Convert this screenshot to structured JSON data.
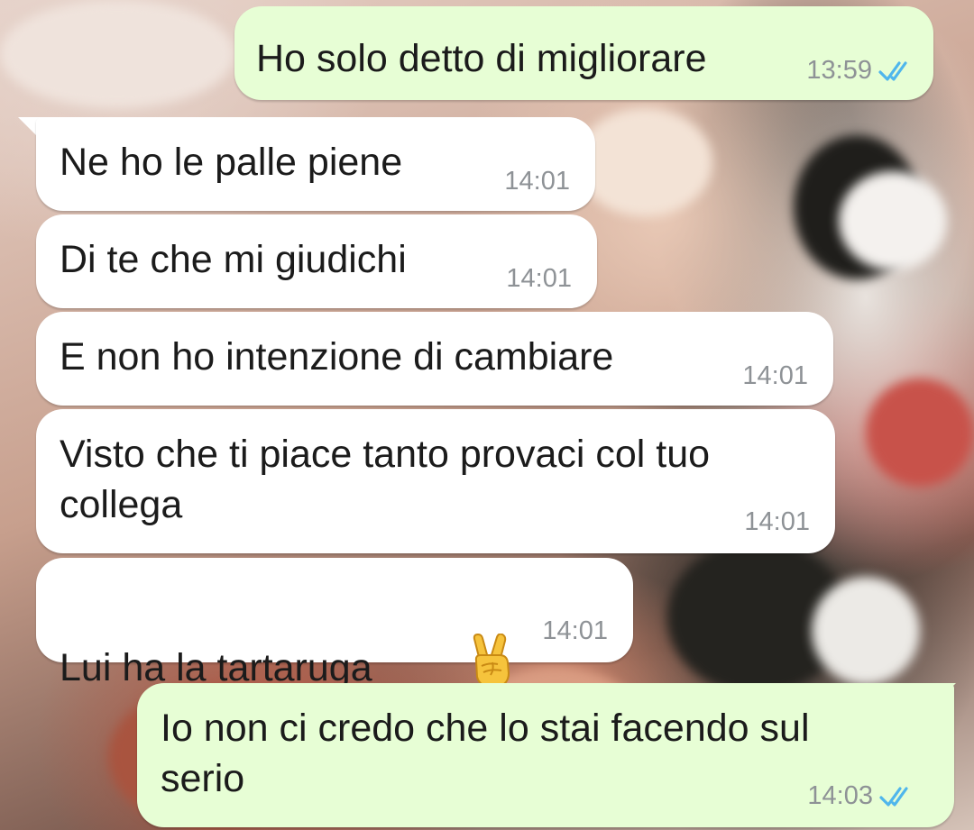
{
  "wallpaper": {
    "description_colors": [
      "#e7d2c8",
      "#c79f8d",
      "#2a2a26",
      "#c8564e"
    ]
  },
  "colors": {
    "incoming_bubble": "#ffffff",
    "outgoing_bubble": "#e7fed5",
    "time_text": "#8e9296",
    "read_ticks": "#4fb6ec"
  },
  "messages": [
    {
      "direction": "out",
      "text": "Ho solo detto di migliorare",
      "time": "13:59",
      "status": "read"
    },
    {
      "direction": "in",
      "text": "Ne ho le palle piene",
      "time": "14:01"
    },
    {
      "direction": "in",
      "text": "Di te che mi giudichi",
      "time": "14:01"
    },
    {
      "direction": "in",
      "text": "E non ho intenzione di cambiare",
      "time": "14:01"
    },
    {
      "direction": "in",
      "text": "Visto che ti piace tanto provaci col tuo\ncollega",
      "time": "14:01"
    },
    {
      "direction": "in",
      "text": "Lui ha la tartaruga",
      "emoji": "victory-hand-emoji",
      "time": "14:01"
    },
    {
      "direction": "out",
      "text": "Io non ci credo che lo stai facendo sul\nserio",
      "time": "14:03",
      "status": "read"
    }
  ]
}
